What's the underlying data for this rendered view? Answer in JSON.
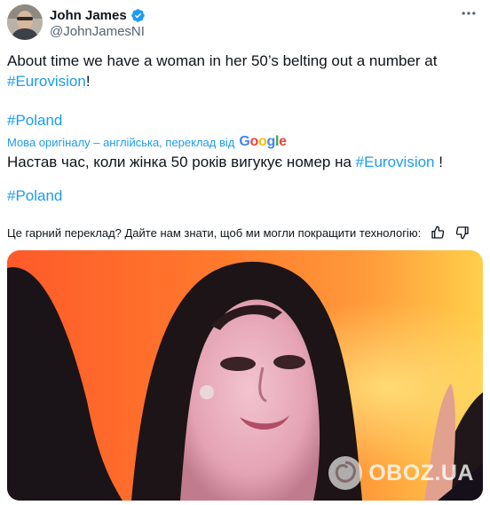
{
  "author": {
    "display_name": "John James",
    "handle": "@JohnJamesNI",
    "verified": true,
    "avatar_icon": "user-avatar"
  },
  "tweet": {
    "original": {
      "line1_text": "About time we have a woman in her 50’s belting out a number at",
      "hashtag_eurovision": "#Eurovision",
      "line2_suffix": "!",
      "hashtag_poland": "#Poland"
    },
    "translation": {
      "attribution": "Мова оригіналу – англійська, переклад від",
      "provider": "Google",
      "text_before": "Настав час, коли жінка 50 років вигукує номер на",
      "hashtag_eurovision": "#Eurovision",
      "text_after": "!",
      "hashtag_poland": "#Poland"
    },
    "feedback_question": "Це гарний переклад? Дайте нам знати, щоб ми могли покращити технологію:"
  },
  "media": {
    "description": "photo",
    "watermark": "OBOZ.UA"
  },
  "colors": {
    "link": "#1d9bf0",
    "text": "#0f1419",
    "secondary": "#536471",
    "google_blue": "#4285f4",
    "google_red": "#ea4335",
    "google_yellow": "#fbbc05",
    "google_green": "#34a853"
  }
}
